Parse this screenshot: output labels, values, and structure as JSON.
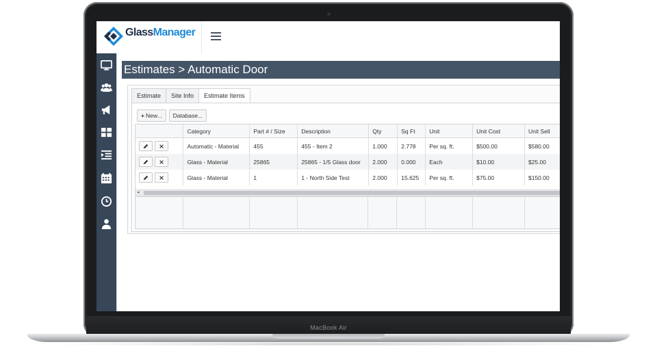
{
  "device": {
    "label": "MacBook Air"
  },
  "app": {
    "logo": {
      "part1": "Glass",
      "part2": "Manager",
      "icon": "diamond-logo-icon",
      "accent_color": "#1f8ad6"
    },
    "menu_icon": "hamburger-icon"
  },
  "sidebar": {
    "items": [
      {
        "icon": "monitor-icon"
      },
      {
        "icon": "users-icon"
      },
      {
        "icon": "megaphone-icon"
      },
      {
        "icon": "grid-icon"
      },
      {
        "icon": "list-indent-icon"
      },
      {
        "icon": "calendar-icon"
      },
      {
        "icon": "clock-icon"
      },
      {
        "icon": "user-icon"
      }
    ],
    "bg_color": "#374759"
  },
  "page": {
    "breadcrumb_parent": "Estimates",
    "breadcrumb_sep": ">",
    "breadcrumb_current": "Automatic Door",
    "title_bar_color": "#455568"
  },
  "tabs": [
    {
      "label": "Estimate",
      "active": false
    },
    {
      "label": "Site Info",
      "active": false
    },
    {
      "label": "Estimate Items",
      "active": true
    }
  ],
  "toolbar": {
    "new_label": "New...",
    "database_label": "Database..."
  },
  "table": {
    "columns": [
      "",
      "Category",
      "Part # / Size",
      "Description",
      "Qty",
      "Sq Ft",
      "Unit",
      "Unit Cost",
      "Unit Sell"
    ],
    "rows": [
      {
        "category": "Automatic - Material",
        "part": "455",
        "description": "455 - Item 2",
        "qty": "1.000",
        "sqft": "2.778",
        "unit": "Per sq. ft.",
        "unit_cost": "$500.00",
        "unit_sell": "$580.00"
      },
      {
        "category": "Glass - Material",
        "part": "25865",
        "description": "25865 - 1/5 Glass door",
        "qty": "2.000",
        "sqft": "0.000",
        "unit": "Each",
        "unit_cost": "$10.00",
        "unit_sell": "$25.00"
      },
      {
        "category": "Glass - Material",
        "part": "1",
        "description": "1 - North Side Test",
        "qty": "2.000",
        "sqft": "15.625",
        "unit": "Per sq. ft.",
        "unit_cost": "$75.00",
        "unit_sell": "$150.00"
      }
    ],
    "row_actions": [
      "pencil-icon",
      "close-icon"
    ]
  }
}
